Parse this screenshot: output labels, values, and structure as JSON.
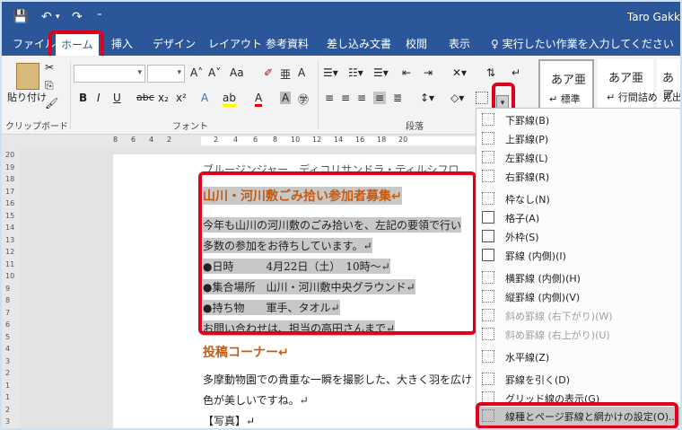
{
  "titlebar": {
    "save_icon": "💾",
    "undo_icon": "↶",
    "redo_icon": "↷",
    "customize_icon": "⁼",
    "user": "Taro Gakk"
  },
  "tabs": {
    "file": "ファイル",
    "home": "ホーム",
    "insert": "挿入",
    "design": "デザイン",
    "layout": "レイアウト",
    "references": "参考資料",
    "mailings": "差し込み文書",
    "review": "校閲",
    "view": "表示",
    "tell_me": "実行したい作業を入力してください"
  },
  "ribbon": {
    "paste_label": "貼り付け",
    "clipboard_label": "クリップボード",
    "font_label": "フォント",
    "paragraph_label": "段落",
    "aa_label": "Aa",
    "bold": "B",
    "italic": "I",
    "underline": "U",
    "strike": "abc",
    "sub": "x₂",
    "sup": "x²",
    "styles": [
      {
        "preview": "あア亜",
        "name": "↵ 標準"
      },
      {
        "preview": "あア亜",
        "name": "↵ 行間詰め"
      },
      {
        "preview": "あア",
        "name": "見出"
      }
    ]
  },
  "ruler": {
    "numbers": [
      "8",
      "6",
      "4",
      "2",
      "2",
      "4",
      "6",
      "8",
      "10",
      "12",
      "14",
      "16",
      "18",
      "20"
    ],
    "vnumbers": [
      "20",
      "19",
      "18",
      "17",
      "16",
      "15",
      "14",
      "13",
      "12",
      "11",
      "10",
      "9",
      "8",
      "7",
      "6",
      "5",
      "4",
      "3",
      "2",
      "1",
      "1",
      "2",
      "3"
    ]
  },
  "document": {
    "lines": [
      "ブルージンジャー、ディコリサンドラ・ティルシフロ",
      "山川・河川敷ごみ拾い参加者募集↵",
      "今年も山川の河川敷のごみ拾いを、左記の要領で行い",
      "多数の参加をお待ちしています。↵",
      "●日時　　　4月22日（土）　10時〜↵",
      "●集合場所　山川・河川敷中央グラウンド↵",
      "●持ち物　　軍手、タオル↵",
      "お問い合わせは、担当の高田さんまで↵",
      "投稿コーナー↵",
      "多摩動物園での貴重な一瞬を撮影した、大きく羽を広け",
      "色が美しいですね。↵",
      "【写真】↵"
    ]
  },
  "menu": {
    "items": [
      {
        "label": "下罫線(B)",
        "disabled": false
      },
      {
        "label": "上罫線(P)",
        "disabled": false
      },
      {
        "label": "左罫線(L)",
        "disabled": false
      },
      {
        "label": "右罫線(R)",
        "disabled": false
      },
      {
        "label": "枠なし(N)",
        "disabled": false
      },
      {
        "label": "格子(A)",
        "disabled": false
      },
      {
        "label": "外枠(S)",
        "disabled": false
      },
      {
        "label": "罫線 (内側)(I)",
        "disabled": false
      },
      {
        "label": "横罫線 (内側)(H)",
        "disabled": false
      },
      {
        "label": "縦罫線 (内側)(V)",
        "disabled": false
      },
      {
        "label": "斜め罫線 (右下がり)(W)",
        "disabled": true
      },
      {
        "label": "斜め罫線 (右上がり)(U)",
        "disabled": true
      },
      {
        "label": "水平線(Z)",
        "disabled": false
      },
      {
        "label": "罫線を引く(D)",
        "disabled": false
      },
      {
        "label": "グリッド線の表示(G)",
        "disabled": false
      },
      {
        "label": "線種とページ罫線と網かけの設定(O)...",
        "disabled": false
      }
    ]
  },
  "colors": {
    "accent": "#2b579a",
    "highlight": "#e0001b",
    "heading": "#c55a11"
  }
}
